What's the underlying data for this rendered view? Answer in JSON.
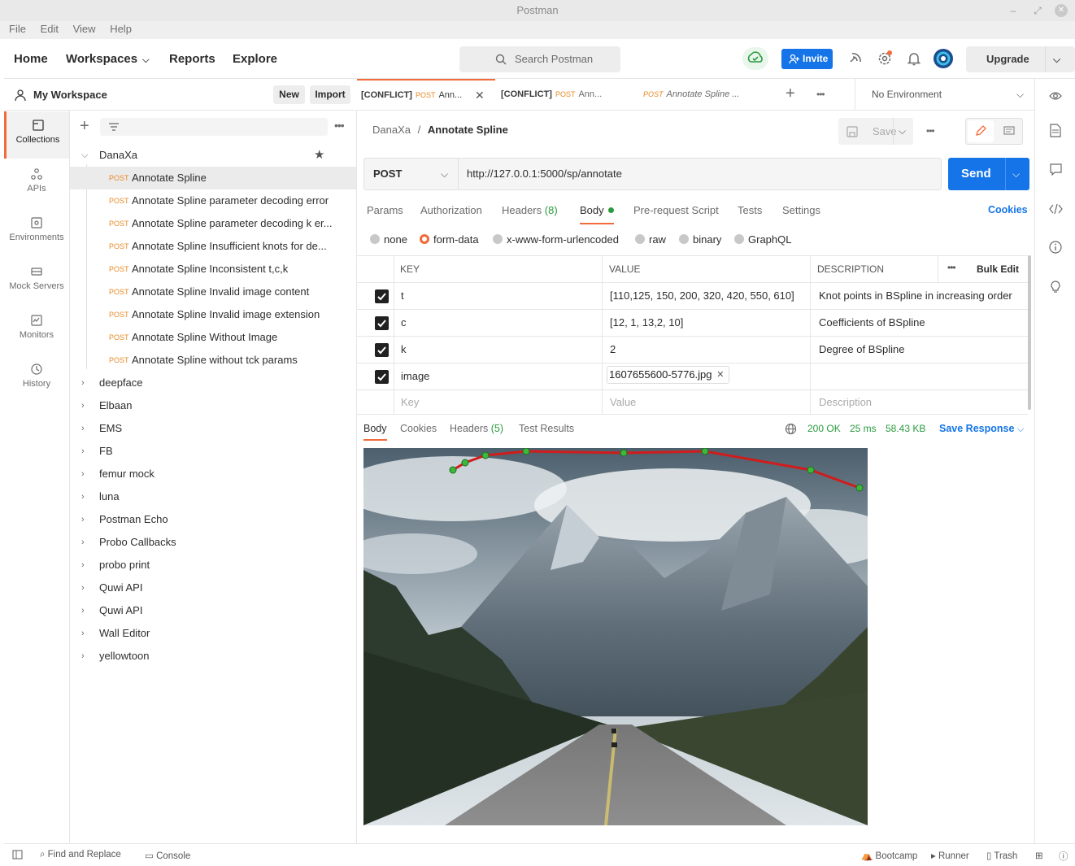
{
  "window": {
    "title": "Postman"
  },
  "menu": [
    "File",
    "Edit",
    "View",
    "Help"
  ],
  "header": {
    "nav": [
      "Home",
      "Workspaces",
      "Reports",
      "Explore"
    ],
    "search_placeholder": "Search Postman",
    "invite_label": "Invite",
    "upgrade_label": "Upgrade"
  },
  "rail": [
    "Collections",
    "APIs",
    "Environments",
    "Mock Servers",
    "Monitors",
    "History"
  ],
  "workspace": {
    "title": "My Workspace",
    "new_label": "New",
    "import_label": "Import"
  },
  "collections": {
    "expanded": "DanaXa",
    "requests": [
      {
        "method": "POST",
        "name": "Annotate Spline"
      },
      {
        "method": "POST",
        "name": "Annotate Spline parameter decoding error"
      },
      {
        "method": "POST",
        "name": "Annotate Spline parameter decoding k er..."
      },
      {
        "method": "POST",
        "name": "Annotate Spline Insufficient knots for de..."
      },
      {
        "method": "POST",
        "name": "Annotate Spline Inconsistent t,c,k"
      },
      {
        "method": "POST",
        "name": "Annotate Spline Invalid image content"
      },
      {
        "method": "POST",
        "name": "Annotate Spline Invalid image extension"
      },
      {
        "method": "POST",
        "name": "Annotate Spline Without Image"
      },
      {
        "method": "POST",
        "name": "Annotate Spline without tck params"
      }
    ],
    "others": [
      "deepface",
      "Elbaan",
      "EMS",
      "FB",
      "femur mock",
      "luna",
      "Postman Echo",
      "Probo Callbacks",
      "probo print",
      "Quwi API",
      "Quwi API",
      "Wall Editor",
      "yellowtoon"
    ]
  },
  "tabs": [
    {
      "prefix": "[CONFLICT]",
      "method": "POST",
      "name": "Ann..."
    },
    {
      "prefix": "[CONFLICT]",
      "method": "POST",
      "name": "Ann..."
    },
    {
      "prefix": "",
      "method": "POST",
      "name": "Annotate Spline ..."
    }
  ],
  "environment": "No Environment",
  "breadcrumb": {
    "parent": "DanaXa",
    "sep": "/",
    "current": "Annotate Spline"
  },
  "save_label": "Save",
  "request": {
    "method": "POST",
    "url": "http://127.0.0.1:5000/sp/annotate",
    "send_label": "Send",
    "tabs": [
      "Params",
      "Authorization",
      "Headers",
      "Body",
      "Pre-request Script",
      "Tests",
      "Settings"
    ],
    "headers_count": "(8)",
    "cookies_label": "Cookies",
    "body_types": [
      "none",
      "form-data",
      "x-www-form-urlencoded",
      "raw",
      "binary",
      "GraphQL"
    ],
    "table": {
      "columns": [
        "KEY",
        "VALUE",
        "DESCRIPTION"
      ],
      "bulk_edit": "Bulk Edit",
      "rows": [
        {
          "key": "t",
          "value": "[110,125, 150, 200, 320, 420, 550, 610]",
          "desc": "Knot points in BSpline in increasing order",
          "checked": true
        },
        {
          "key": "c",
          "value": "[12, 1, 13,2, 10]",
          "desc": "Coefficients of BSpline",
          "checked": true
        },
        {
          "key": "k",
          "value": "2",
          "desc": "Degree of BSpline",
          "checked": true
        },
        {
          "key": "image",
          "value": "1607655600-5776.jpg",
          "desc": "",
          "checked": true
        }
      ],
      "placeholders": {
        "key": "Key",
        "value": "Value",
        "desc": "Description"
      }
    }
  },
  "response": {
    "tabs": [
      "Body",
      "Cookies",
      "Headers",
      "Test Results"
    ],
    "headers_count": "(5)",
    "status": "200 OK",
    "time": "25 ms",
    "size": "58.43 KB",
    "save_label": "Save Response"
  },
  "statusbar": {
    "find_replace": "Find and Replace",
    "console": "Console",
    "bootcamp": "Bootcamp",
    "runner": "Runner",
    "trash": "Trash"
  }
}
